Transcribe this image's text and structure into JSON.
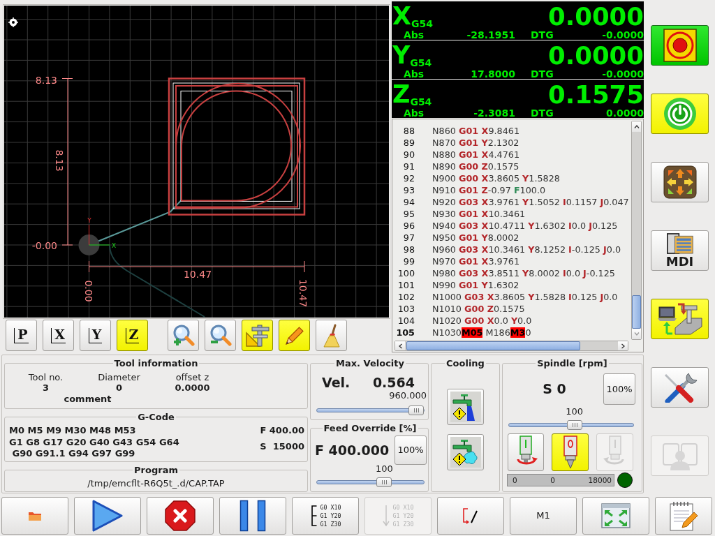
{
  "plot": {
    "labels": [
      {
        "kind": "y-max",
        "text": "8.13"
      },
      {
        "kind": "y-length",
        "text": "8.13"
      },
      {
        "kind": "y-min",
        "text": "-0.00"
      },
      {
        "kind": "x-length",
        "text": "10.47"
      },
      {
        "kind": "x-min",
        "text": "0.00"
      },
      {
        "kind": "x-max",
        "text": "10.47"
      }
    ],
    "axes": [
      {
        "kind": "y",
        "text": "Y"
      },
      {
        "kind": "x",
        "text": "X"
      }
    ]
  },
  "view_buttons": [
    {
      "label": "P",
      "selected": false
    },
    {
      "label": "X",
      "selected": false
    },
    {
      "label": "Y",
      "selected": false
    },
    {
      "label": "Z",
      "selected": true
    }
  ],
  "plot_tools": [
    {
      "kind": "zoom-in",
      "on": false
    },
    {
      "kind": "zoom-out",
      "on": false
    },
    {
      "kind": "dimensions",
      "on": true
    },
    {
      "kind": "tool-path",
      "on": true
    },
    {
      "kind": "clear",
      "on": false
    }
  ],
  "dro": [
    {
      "axis": "X",
      "system": "G54",
      "value": "0.0000",
      "abs_label": "Abs",
      "abs": "-28.1951",
      "dtg_label": "DTG",
      "dtg": "-0.0000"
    },
    {
      "axis": "Y",
      "system": "G54",
      "value": "0.0000",
      "abs_label": "Abs",
      "abs": "17.8000",
      "dtg_label": "DTG",
      "dtg": "-0.0000"
    },
    {
      "axis": "Z",
      "system": "G54",
      "value": "0.1575",
      "abs_label": "Abs",
      "abs": "-2.3081",
      "dtg_label": "DTG",
      "dtg": "0.0000"
    }
  ],
  "gcode_view": {
    "lines": [
      {
        "number": "88",
        "current": false,
        "segments": [
          {
            "kind": "plain",
            "text": "N860 "
          },
          {
            "kind": "code",
            "text": "G01 X"
          },
          {
            "kind": "plain",
            "text": "9.8461"
          }
        ]
      },
      {
        "number": "89",
        "current": false,
        "segments": [
          {
            "kind": "plain",
            "text": "N870 "
          },
          {
            "kind": "code",
            "text": "G01 Y"
          },
          {
            "kind": "plain",
            "text": "2.1302"
          }
        ]
      },
      {
        "number": "90",
        "current": false,
        "segments": [
          {
            "kind": "plain",
            "text": "N880 "
          },
          {
            "kind": "code",
            "text": "G01 X"
          },
          {
            "kind": "plain",
            "text": "4.4761"
          }
        ]
      },
      {
        "number": "91",
        "current": false,
        "segments": [
          {
            "kind": "plain",
            "text": "N890 "
          },
          {
            "kind": "code",
            "text": "G00 Z"
          },
          {
            "kind": "plain",
            "text": "0.1575"
          }
        ]
      },
      {
        "number": "92",
        "current": false,
        "segments": [
          {
            "kind": "plain",
            "text": "N900 "
          },
          {
            "kind": "code",
            "text": "G00 X"
          },
          {
            "kind": "plain",
            "text": "3.8605 "
          },
          {
            "kind": "code",
            "text": "Y"
          },
          {
            "kind": "plain",
            "text": "1.5828"
          }
        ]
      },
      {
        "number": "93",
        "current": false,
        "segments": [
          {
            "kind": "plain",
            "text": "N910 "
          },
          {
            "kind": "code",
            "text": "G01 Z"
          },
          {
            "kind": "plain",
            "text": "-0.97 "
          },
          {
            "kind": "feed",
            "text": "F"
          },
          {
            "kind": "plain",
            "text": "100.0"
          }
        ]
      },
      {
        "number": "94",
        "current": false,
        "segments": [
          {
            "kind": "plain",
            "text": "N920 "
          },
          {
            "kind": "code",
            "text": "G03 X"
          },
          {
            "kind": "plain",
            "text": "3.9761 "
          },
          {
            "kind": "code",
            "text": "Y"
          },
          {
            "kind": "plain",
            "text": "1.5052 "
          },
          {
            "kind": "code",
            "text": "I"
          },
          {
            "kind": "plain",
            "text": "0.1157 "
          },
          {
            "kind": "code",
            "text": "J"
          },
          {
            "kind": "plain",
            "text": "0.047"
          }
        ]
      },
      {
        "number": "95",
        "current": false,
        "segments": [
          {
            "kind": "plain",
            "text": "N930 "
          },
          {
            "kind": "code",
            "text": "G01 X"
          },
          {
            "kind": "plain",
            "text": "10.3461"
          }
        ]
      },
      {
        "number": "96",
        "current": false,
        "segments": [
          {
            "kind": "plain",
            "text": "N940 "
          },
          {
            "kind": "code",
            "text": "G03 X"
          },
          {
            "kind": "plain",
            "text": "10.4711 "
          },
          {
            "kind": "code",
            "text": "Y"
          },
          {
            "kind": "plain",
            "text": "1.6302 "
          },
          {
            "kind": "code",
            "text": "I"
          },
          {
            "kind": "plain",
            "text": "0.0 "
          },
          {
            "kind": "code",
            "text": "J"
          },
          {
            "kind": "plain",
            "text": "0.125"
          }
        ]
      },
      {
        "number": "97",
        "current": false,
        "segments": [
          {
            "kind": "plain",
            "text": "N950 "
          },
          {
            "kind": "code",
            "text": "G01 Y"
          },
          {
            "kind": "plain",
            "text": "8.0002"
          }
        ]
      },
      {
        "number": "98",
        "current": false,
        "segments": [
          {
            "kind": "plain",
            "text": "N960 "
          },
          {
            "kind": "code",
            "text": "G03 X"
          },
          {
            "kind": "plain",
            "text": "10.3461 "
          },
          {
            "kind": "code",
            "text": "Y"
          },
          {
            "kind": "plain",
            "text": "8.1252 "
          },
          {
            "kind": "code",
            "text": "I"
          },
          {
            "kind": "plain",
            "text": "-0.125 "
          },
          {
            "kind": "code",
            "text": "J"
          },
          {
            "kind": "plain",
            "text": "0.0"
          }
        ]
      },
      {
        "number": "99",
        "current": false,
        "segments": [
          {
            "kind": "plain",
            "text": "N970 "
          },
          {
            "kind": "code",
            "text": "G01 X"
          },
          {
            "kind": "plain",
            "text": "3.9761"
          }
        ]
      },
      {
        "number": "100",
        "current": false,
        "segments": [
          {
            "kind": "plain",
            "text": "N980 "
          },
          {
            "kind": "code",
            "text": "G03 X"
          },
          {
            "kind": "plain",
            "text": "3.8511 "
          },
          {
            "kind": "code",
            "text": "Y"
          },
          {
            "kind": "plain",
            "text": "8.0002 "
          },
          {
            "kind": "code",
            "text": "I"
          },
          {
            "kind": "plain",
            "text": "0.0 "
          },
          {
            "kind": "code",
            "text": "J"
          },
          {
            "kind": "plain",
            "text": "-0.125"
          }
        ]
      },
      {
        "number": "101",
        "current": false,
        "segments": [
          {
            "kind": "plain",
            "text": "N990 "
          },
          {
            "kind": "code",
            "text": "G01 Y"
          },
          {
            "kind": "plain",
            "text": "1.6302"
          }
        ]
      },
      {
        "number": "102",
        "current": false,
        "segments": [
          {
            "kind": "plain",
            "text": "N1000 "
          },
          {
            "kind": "code",
            "text": "G03 X"
          },
          {
            "kind": "plain",
            "text": "3.8605 "
          },
          {
            "kind": "code",
            "text": "Y"
          },
          {
            "kind": "plain",
            "text": "1.5828 "
          },
          {
            "kind": "code",
            "text": "I"
          },
          {
            "kind": "plain",
            "text": "0.125 "
          },
          {
            "kind": "code",
            "text": "J"
          },
          {
            "kind": "plain",
            "text": "0.0"
          }
        ]
      },
      {
        "number": "103",
        "current": false,
        "segments": [
          {
            "kind": "plain",
            "text": "N1010 "
          },
          {
            "kind": "code",
            "text": "G00 Z"
          },
          {
            "kind": "plain",
            "text": "0.1575"
          }
        ]
      },
      {
        "number": "104",
        "current": false,
        "segments": [
          {
            "kind": "plain",
            "text": "N1020 "
          },
          {
            "kind": "code",
            "text": "G00 X"
          },
          {
            "kind": "plain",
            "text": "0.0 "
          },
          {
            "kind": "code",
            "text": "Y"
          },
          {
            "kind": "plain",
            "text": "0.0"
          }
        ]
      },
      {
        "number": "105",
        "current": true,
        "segments": [
          {
            "kind": "plain",
            "text": "N1030"
          },
          {
            "kind": "mark",
            "text": "M05"
          },
          {
            "kind": "plain",
            "text": " M186"
          },
          {
            "kind": "mark",
            "text": "M3"
          },
          {
            "kind": "plain",
            "text": "0"
          }
        ]
      }
    ]
  },
  "mode_buttons": [
    {
      "kind": "estop",
      "selected": true,
      "disabled": false
    },
    {
      "kind": "power",
      "selected": true,
      "disabled": false
    },
    {
      "kind": "manual",
      "selected": false,
      "disabled": false
    },
    {
      "kind": "mdi",
      "label": "MDI",
      "selected": false,
      "disabled": false
    },
    {
      "kind": "auto",
      "selected": true,
      "disabled": false
    },
    {
      "kind": "settings",
      "selected": false,
      "disabled": false
    },
    {
      "kind": "user-tabs",
      "selected": false,
      "disabled": true
    }
  ],
  "tool_information": {
    "title": "Tool information",
    "fields": [
      {
        "label": "Tool no.",
        "value": "3"
      },
      {
        "label": "Diameter",
        "value": "0"
      },
      {
        "label": "offset z",
        "value": "0.0000"
      }
    ],
    "comment": "comment"
  },
  "active_gcode": {
    "title": "G-Code",
    "codes": [
      "M0 M5 M9 M30 M48 M53",
      "G1 G8 G17 G20 G40 G43 G54 G64",
      " G90 G91.1 G94 G97 G99"
    ],
    "feed": "F 400.00",
    "speed": "S  15000"
  },
  "program": {
    "title": "Program",
    "path": "/tmp/emcflt-R6Q5t_.d/CAP.TAP"
  },
  "max_velocity": {
    "title": "Max. Velocity",
    "label": "Vel.",
    "value": "0.564",
    "max": "960.000",
    "level": 1.0
  },
  "feed_override": {
    "title": "Feed Override [%]",
    "feed": "F 400.000",
    "reset": "100%",
    "value": "100",
    "level": 0.65
  },
  "cooling": {
    "title": "Cooling",
    "buttons": [
      {
        "kind": "flood",
        "on": false
      },
      {
        "kind": "mist",
        "on": false
      }
    ]
  },
  "spindle": {
    "title": "Spindle [rpm]",
    "speed": "S 0",
    "reset": "100%",
    "value": "100",
    "level": 0.53,
    "buttons": [
      {
        "kind": "forward",
        "selected": false,
        "disabled": false
      },
      {
        "kind": "stop",
        "selected": true,
        "disabled": false
      },
      {
        "kind": "reverse",
        "selected": false,
        "disabled": true
      }
    ],
    "bar": {
      "min": "0",
      "value": "0",
      "max": "18000"
    },
    "at_speed": true
  },
  "toolbar": [
    {
      "kind": "open",
      "disabled": false
    },
    {
      "kind": "run",
      "disabled": false
    },
    {
      "kind": "stop",
      "disabled": false
    },
    {
      "kind": "pause",
      "disabled": false
    },
    {
      "kind": "step",
      "lines": [
        "G0 X10",
        "G1 Y20",
        "G1 Z30"
      ],
      "disabled": false
    },
    {
      "kind": "run-from-line",
      "lines": [
        "G0 X10",
        "G1 Y20",
        "G1 Z30"
      ],
      "disabled": true
    },
    {
      "kind": "block-delete",
      "disabled": false
    },
    {
      "kind": "optional-stop",
      "label": "M1",
      "disabled": false
    },
    {
      "kind": "fullscreen",
      "disabled": false
    },
    {
      "kind": "edit",
      "disabled": false
    }
  ]
}
